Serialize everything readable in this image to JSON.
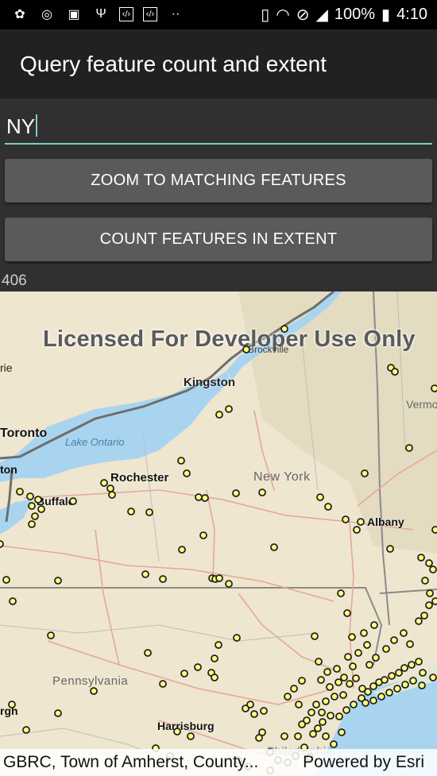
{
  "status_bar": {
    "battery": "100%",
    "time": "4:10",
    "left_icons": [
      "settings-app-icon",
      "browser-icon",
      "image-icon",
      "usb-icon",
      "code-icon",
      "code-icon-2"
    ],
    "right_icons": [
      "vibrate-icon",
      "wifi-icon",
      "no-sim-icon",
      "signal-icon",
      "battery-icon"
    ]
  },
  "app_bar": {
    "title": "Query feature count and extent"
  },
  "query_input": {
    "value": "NY"
  },
  "buttons": {
    "zoom": "ZOOM TO MATCHING FEATURES",
    "count": "COUNT FEATURES IN EXTENT"
  },
  "result_count": "406",
  "map": {
    "watermark": "Licensed For Developer Use Only",
    "labels": {
      "rie": "rie",
      "kingston": "Kingston",
      "brockville": "Brockville",
      "vermont": "Vermo",
      "toronto": "Toronto",
      "lake_ontario": "Lake Ontario",
      "ton": "ton",
      "rochester": "Rochester",
      "buffalo": "Buffalo",
      "new_york": "New York",
      "albany": "Albany",
      "pennsylvania": "Pennsylvania",
      "rgh": "rgh",
      "harrisburg": "Harrisburg",
      "philadelphia": "Philadelphia"
    },
    "attribution_left": "GBRC, Town of Amherst, County...",
    "attribution_right": "Powered by Esri",
    "colors": {
      "water": "#a8d4f0",
      "land": "#efe6cf",
      "point_fill": "#ffff80",
      "point_stroke": "#222222"
    }
  }
}
